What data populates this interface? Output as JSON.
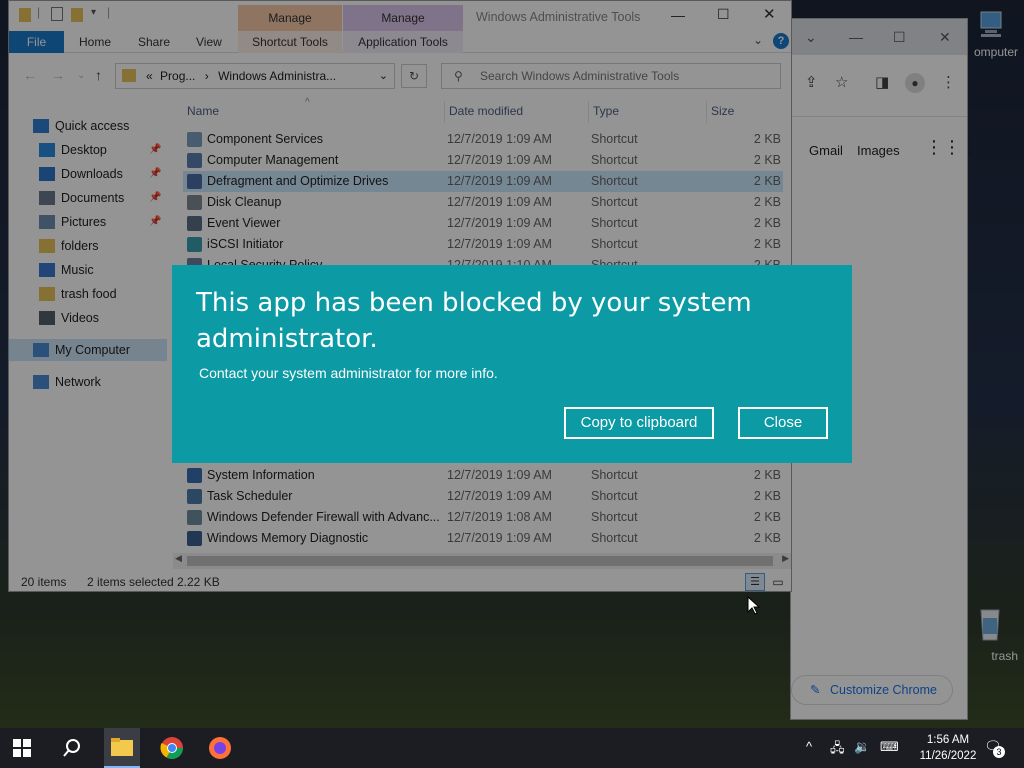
{
  "desktop": {
    "icons": [
      {
        "label": "omputer"
      },
      {
        "label": "trash"
      }
    ]
  },
  "chrome": {
    "links": [
      "Gmail",
      "Images"
    ],
    "customize": "Customize Chrome"
  },
  "explorer": {
    "window_title": "Windows Administrative Tools",
    "context_tabs": [
      {
        "label": "Manage",
        "sub": "Shortcut Tools",
        "color": "#f4c8a8"
      },
      {
        "label": "Manage",
        "sub": "Application Tools",
        "color": "#d9c6ec"
      }
    ],
    "ribbon_tabs": [
      "File",
      "Home",
      "Share",
      "View"
    ],
    "address": {
      "prefix": "«",
      "path1": "Prog...",
      "sep": "›",
      "path2": "Windows Administra..."
    },
    "search_placeholder": "Search Windows Administrative Tools",
    "nav": [
      {
        "label": "Quick access",
        "icon": "star-icon",
        "pinned": false
      },
      {
        "label": "Desktop",
        "icon": "desktop-icon",
        "pinned": true
      },
      {
        "label": "Downloads",
        "icon": "download-icon",
        "pinned": true
      },
      {
        "label": "Documents",
        "icon": "documents-icon",
        "pinned": true
      },
      {
        "label": "Pictures",
        "icon": "pictures-icon",
        "pinned": true
      },
      {
        "label": "folders",
        "icon": "folder-icon",
        "pinned": false
      },
      {
        "label": "Music",
        "icon": "music-icon",
        "pinned": false
      },
      {
        "label": "trash food",
        "icon": "folder-icon",
        "pinned": false
      },
      {
        "label": "Videos",
        "icon": "videos-icon",
        "pinned": false
      },
      {
        "label": "My Computer",
        "icon": "computer-icon",
        "pinned": false
      },
      {
        "label": "Network",
        "icon": "network-icon",
        "pinned": false
      }
    ],
    "columns": [
      "Name",
      "Date modified",
      "Type",
      "Size"
    ],
    "rows": [
      {
        "name": "Component Services",
        "date": "12/7/2019 1:09 AM",
        "type": "Shortcut",
        "size": "2 KB"
      },
      {
        "name": "Computer Management",
        "date": "12/7/2019 1:09 AM",
        "type": "Shortcut",
        "size": "2 KB"
      },
      {
        "name": "Defragment and Optimize Drives",
        "date": "12/7/2019 1:09 AM",
        "type": "Shortcut",
        "size": "2 KB"
      },
      {
        "name": "Disk Cleanup",
        "date": "12/7/2019 1:09 AM",
        "type": "Shortcut",
        "size": "2 KB"
      },
      {
        "name": "Event Viewer",
        "date": "12/7/2019 1:09 AM",
        "type": "Shortcut",
        "size": "2 KB"
      },
      {
        "name": "iSCSI Initiator",
        "date": "12/7/2019 1:09 AM",
        "type": "Shortcut",
        "size": "2 KB"
      },
      {
        "name": "Local Security Policy",
        "date": "12/7/2019 1:10 AM",
        "type": "Shortcut",
        "size": "2 KB"
      },
      {
        "name": "System Information",
        "date": "12/7/2019 1:09 AM",
        "type": "Shortcut",
        "size": "2 KB"
      },
      {
        "name": "Task Scheduler",
        "date": "12/7/2019 1:09 AM",
        "type": "Shortcut",
        "size": "2 KB"
      },
      {
        "name": "Windows Defender Firewall with Advanc...",
        "date": "12/7/2019 1:08 AM",
        "type": "Shortcut",
        "size": "2 KB"
      },
      {
        "name": "Windows Memory Diagnostic",
        "date": "12/7/2019 1:09 AM",
        "type": "Shortcut",
        "size": "2 KB"
      }
    ],
    "status": {
      "count": "20 items",
      "selected": "2 items selected",
      "size": "2.22 KB"
    }
  },
  "dialog": {
    "title": "This app has been blocked by your system administrator.",
    "message": "Contact your system administrator for more info.",
    "copy_label": "Copy to clipboard",
    "close_label": "Close",
    "accent": "#0c9aa4"
  },
  "taskbar": {
    "time": "1:56 AM",
    "date": "11/26/2022",
    "notifications": "3"
  }
}
